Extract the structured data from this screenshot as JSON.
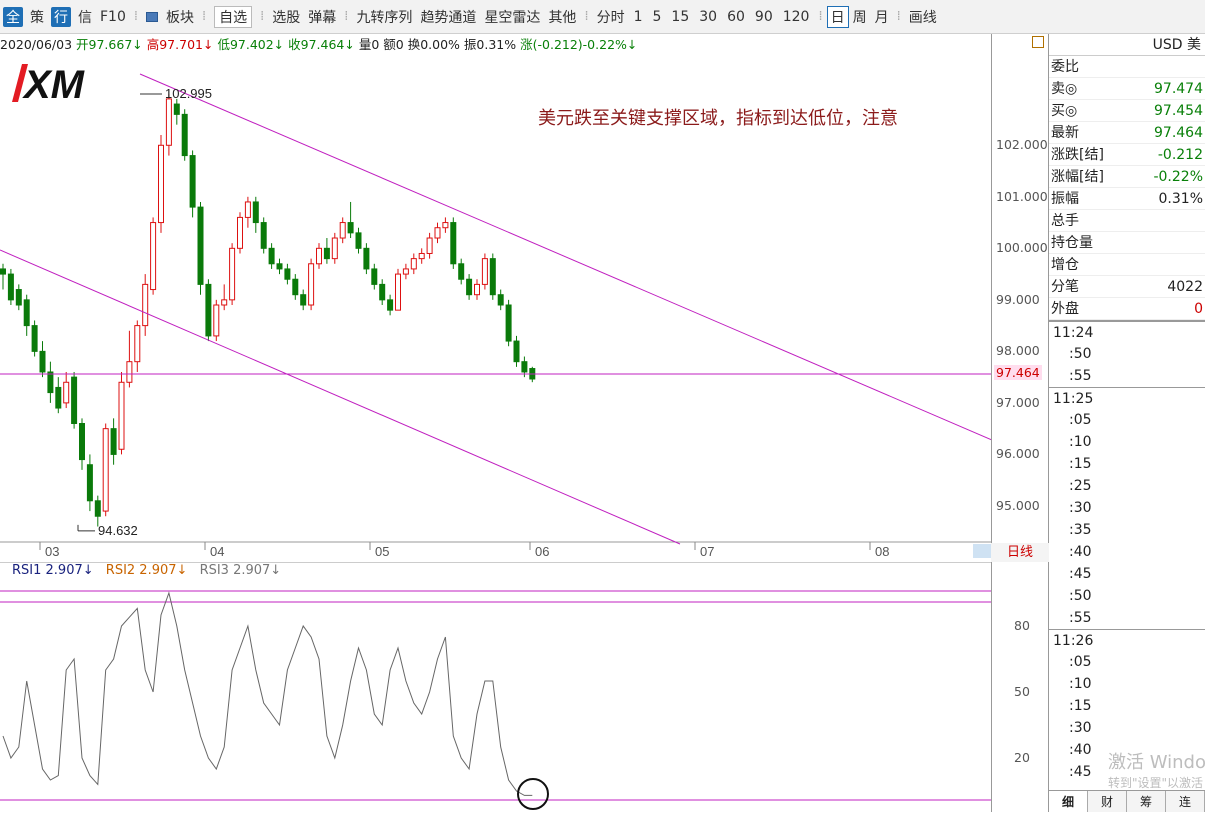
{
  "toolbar": {
    "items": [
      "全",
      "策",
      "行",
      "信",
      "F10",
      "",
      "板块",
      "自选",
      "选股",
      "弹幕",
      "九转序列",
      "趋势通道",
      "星空雷达",
      "其他",
      "分时",
      "1",
      "5",
      "15",
      "30",
      "60",
      "90",
      "120",
      "日",
      "周",
      "月",
      "画线"
    ]
  },
  "infobar": {
    "date": "2020/06/03",
    "open": "开97.667↓",
    "high": "高97.701↓",
    "low": "低97.402↓",
    "close": "收97.464↓",
    "vol": "量0",
    "amt": "额0",
    "turnover": "换0.00%",
    "amplitude": "振0.31%",
    "change": "涨(-0.212)-0.22%↓"
  },
  "annotation": "美元跌至关键支撑区域，指标到达低位，注意",
  "logo": "XM",
  "price_labels": {
    "high": "102.995",
    "low": "94.632",
    "last": "97.464"
  },
  "yaxis": [
    "102.000",
    "101.000",
    "100.000",
    "99.000",
    "98.000",
    "97.000",
    "96.000",
    "95.000"
  ],
  "xaxis": [
    "03",
    "04",
    "05",
    "06",
    "07",
    "08"
  ],
  "period_label": "日线",
  "rsi": {
    "rsi1": "RSI1 2.907↓",
    "rsi2": "RSI2 2.907↓",
    "rsi3": "RSI3 2.907↓",
    "axis": [
      "80",
      "50",
      "20"
    ]
  },
  "quote": {
    "header": "USD 美",
    "rows": [
      {
        "label": "委比",
        "value": "",
        "color": ""
      },
      {
        "label": "卖◎",
        "value": "97.474",
        "color": "green"
      },
      {
        "label": "买◎",
        "value": "97.454",
        "color": "green"
      },
      {
        "label": "最新",
        "value": "97.464",
        "color": "green"
      },
      {
        "label": "涨跌[结]",
        "value": "-0.212",
        "color": "green"
      },
      {
        "label": "涨幅[结]",
        "value": "-0.22%",
        "color": "green"
      },
      {
        "label": "振幅",
        "value": "0.31%",
        "color": ""
      },
      {
        "label": "总手",
        "value": "",
        "color": ""
      },
      {
        "label": "持仓量",
        "value": "",
        "color": ""
      },
      {
        "label": "增仓",
        "value": "",
        "color": ""
      },
      {
        "label": "分笔",
        "value": "4022",
        "color": ""
      },
      {
        "label": "外盘",
        "value": "0",
        "color": "red"
      }
    ],
    "ticks": [
      "11:24",
      ":50",
      ":55",
      "11:25",
      ":05",
      ":10",
      ":15",
      ":25",
      ":30",
      ":35",
      ":40",
      ":45",
      ":50",
      ":55",
      "11:26",
      ":05",
      ":10",
      ":15",
      ":30",
      ":40",
      ":45"
    ],
    "tabs": [
      "细",
      "财",
      "筹",
      "连"
    ]
  },
  "watermark": {
    "line1": "激活 Windows",
    "line2": "转到\"设置\"以激活"
  },
  "chart_data": {
    "type": "candlestick",
    "ylim": [
      94.3,
      103.5
    ],
    "candles": [
      [
        99.6,
        99.5,
        99.7,
        99.2
      ],
      [
        99.5,
        99.0,
        99.6,
        98.9
      ],
      [
        99.2,
        98.9,
        99.3,
        98.8
      ],
      [
        99.0,
        98.5,
        99.1,
        98.3
      ],
      [
        98.5,
        98.0,
        98.6,
        97.9
      ],
      [
        98.0,
        97.6,
        98.2,
        97.5
      ],
      [
        97.6,
        97.2,
        97.8,
        97.0
      ],
      [
        97.3,
        96.9,
        97.5,
        96.8
      ],
      [
        97.0,
        97.4,
        97.6,
        96.9
      ],
      [
        97.5,
        96.6,
        97.6,
        96.5
      ],
      [
        96.6,
        95.9,
        96.7,
        95.7
      ],
      [
        95.8,
        95.1,
        96.0,
        94.9
      ],
      [
        95.1,
        94.8,
        95.2,
        94.6
      ],
      [
        94.9,
        96.5,
        96.6,
        94.8
      ],
      [
        96.5,
        96.0,
        96.7,
        95.8
      ],
      [
        96.1,
        97.4,
        97.6,
        96.0
      ],
      [
        97.4,
        97.8,
        98.4,
        97.3
      ],
      [
        97.8,
        98.5,
        98.6,
        97.6
      ],
      [
        98.5,
        99.3,
        99.5,
        98.3
      ],
      [
        99.2,
        100.5,
        100.6,
        99.1
      ],
      [
        100.5,
        102.0,
        102.2,
        100.3
      ],
      [
        102.0,
        102.9,
        102.995,
        101.8
      ],
      [
        102.8,
        102.6,
        102.9,
        102.4
      ],
      [
        102.6,
        101.8,
        102.7,
        101.7
      ],
      [
        101.8,
        100.8,
        101.9,
        100.6
      ],
      [
        100.8,
        99.3,
        100.9,
        99.1
      ],
      [
        99.3,
        98.3,
        99.4,
        98.2
      ],
      [
        98.3,
        98.9,
        99.0,
        98.2
      ],
      [
        98.9,
        99.0,
        99.3,
        98.8
      ],
      [
        99.0,
        100.0,
        100.1,
        98.9
      ],
      [
        100.0,
        100.6,
        100.7,
        99.9
      ],
      [
        100.6,
        100.9,
        101.0,
        100.4
      ],
      [
        100.9,
        100.5,
        101.0,
        100.3
      ],
      [
        100.5,
        100.0,
        100.6,
        99.9
      ],
      [
        100.0,
        99.7,
        100.1,
        99.6
      ],
      [
        99.7,
        99.6,
        99.8,
        99.5
      ],
      [
        99.6,
        99.4,
        99.7,
        99.3
      ],
      [
        99.4,
        99.1,
        99.5,
        99.0
      ],
      [
        99.1,
        98.9,
        99.2,
        98.8
      ],
      [
        98.9,
        99.7,
        99.8,
        98.8
      ],
      [
        99.7,
        100.0,
        100.1,
        99.6
      ],
      [
        100.0,
        99.8,
        100.2,
        99.7
      ],
      [
        99.8,
        100.2,
        100.3,
        99.7
      ],
      [
        100.2,
        100.5,
        100.6,
        100.1
      ],
      [
        100.5,
        100.3,
        100.9,
        100.2
      ],
      [
        100.3,
        100.0,
        100.4,
        99.9
      ],
      [
        100.0,
        99.6,
        100.1,
        99.5
      ],
      [
        99.6,
        99.3,
        99.7,
        99.2
      ],
      [
        99.3,
        99.0,
        99.4,
        98.9
      ],
      [
        99.0,
        98.8,
        99.1,
        98.7
      ],
      [
        98.8,
        99.5,
        99.6,
        98.8
      ],
      [
        99.5,
        99.6,
        99.7,
        99.4
      ],
      [
        99.6,
        99.8,
        99.9,
        99.5
      ],
      [
        99.8,
        99.9,
        100.0,
        99.7
      ],
      [
        99.9,
        100.2,
        100.3,
        99.8
      ],
      [
        100.2,
        100.4,
        100.5,
        100.1
      ],
      [
        100.4,
        100.5,
        100.6,
        100.3
      ],
      [
        100.5,
        99.7,
        100.6,
        99.6
      ],
      [
        99.7,
        99.4,
        99.8,
        99.3
      ],
      [
        99.4,
        99.1,
        99.5,
        99.0
      ],
      [
        99.1,
        99.3,
        99.4,
        99.0
      ],
      [
        99.3,
        99.8,
        99.9,
        99.2
      ],
      [
        99.8,
        99.1,
        99.9,
        99.0
      ],
      [
        99.1,
        98.9,
        99.2,
        98.8
      ],
      [
        98.9,
        98.2,
        99.0,
        98.1
      ],
      [
        98.2,
        97.8,
        98.3,
        97.7
      ],
      [
        97.8,
        97.6,
        97.9,
        97.5
      ],
      [
        97.667,
        97.464,
        97.701,
        97.402
      ]
    ],
    "rsi": [
      30,
      20,
      25,
      55,
      35,
      15,
      10,
      12,
      60,
      65,
      20,
      12,
      8,
      60,
      65,
      80,
      84,
      88,
      60,
      50,
      85,
      95,
      80,
      60,
      45,
      30,
      20,
      15,
      25,
      60,
      70,
      80,
      60,
      45,
      40,
      35,
      60,
      70,
      80,
      75,
      65,
      30,
      20,
      35,
      55,
      70,
      60,
      40,
      35,
      60,
      70,
      55,
      45,
      40,
      50,
      65,
      75,
      30,
      20,
      15,
      40,
      55,
      55,
      25,
      10,
      5,
      3,
      3
    ]
  }
}
